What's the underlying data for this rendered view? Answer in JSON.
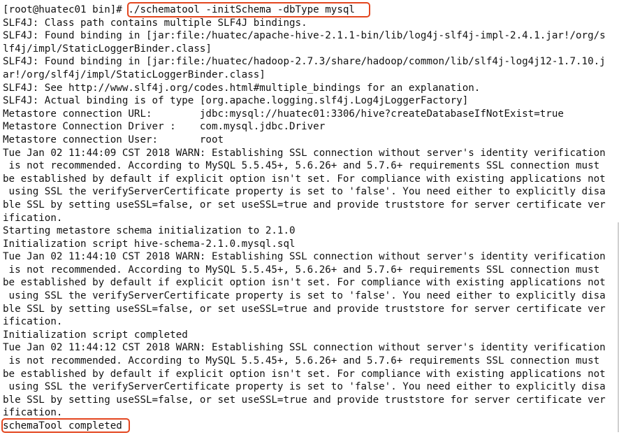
{
  "terminal": {
    "prompt": "[root@huatec01 bin]# ",
    "command": "./schematool -initSchema -dbType mysql",
    "output": [
      "SLF4J: Class path contains multiple SLF4J bindings.",
      "SLF4J: Found binding in [jar:file:/huatec/apache-hive-2.1.1-bin/lib/log4j-slf4j-impl-2.4.1.jar!/org/s",
      "lf4j/impl/StaticLoggerBinder.class]",
      "SLF4J: Found binding in [jar:file:/huatec/hadoop-2.7.3/share/hadoop/common/lib/slf4j-log4j12-1.7.10.j",
      "ar!/org/slf4j/impl/StaticLoggerBinder.class]",
      "SLF4J: See http://www.slf4j.org/codes.html#multiple_bindings for an explanation.",
      "SLF4J: Actual binding is of type [org.apache.logging.slf4j.Log4jLoggerFactory]",
      "Metastore connection URL:        jdbc:mysql://huatec01:3306/hive?createDatabaseIfNotExist=true",
      "Metastore Connection Driver :    com.mysql.jdbc.Driver",
      "Metastore connection User:       root",
      "Tue Jan 02 11:44:09 CST 2018 WARN: Establishing SSL connection without server's identity verification",
      " is not recommended. According to MySQL 5.5.45+, 5.6.26+ and 5.7.6+ requirements SSL connection must",
      "be established by default if explicit option isn't set. For compliance with existing applications not",
      " using SSL the verifyServerCertificate property is set to 'false'. You need either to explicitly disa",
      "ble SSL by setting useSSL=false, or set useSSL=true and provide truststore for server certificate ver",
      "ification.",
      "Starting metastore schema initialization to 2.1.0",
      "Initialization script hive-schema-2.1.0.mysql.sql",
      "Tue Jan 02 11:44:10 CST 2018 WARN: Establishing SSL connection without server's identity verification",
      " is not recommended. According to MySQL 5.5.45+, 5.6.26+ and 5.7.6+ requirements SSL connection must",
      "be established by default if explicit option isn't set. For compliance with existing applications not",
      " using SSL the verifyServerCertificate property is set to 'false'. You need either to explicitly disa",
      "ble SSL by setting useSSL=false, or set useSSL=true and provide truststore for server certificate ver",
      "ification.",
      "Initialization script completed",
      "Tue Jan 02 11:44:12 CST 2018 WARN: Establishing SSL connection without server's identity verification",
      " is not recommended. According to MySQL 5.5.45+, 5.6.26+ and 5.7.6+ requirements SSL connection must",
      "be established by default if explicit option isn't set. For compliance with existing applications not",
      " using SSL the verifyServerCertificate property is set to 'false'. You need either to explicitly disa",
      "ble SSL by setting useSSL=false, or set useSSL=true and provide truststore for server certificate ver",
      "ification."
    ],
    "final_line": "schemaTool completed",
    "highlight_color": "#e3461f"
  }
}
